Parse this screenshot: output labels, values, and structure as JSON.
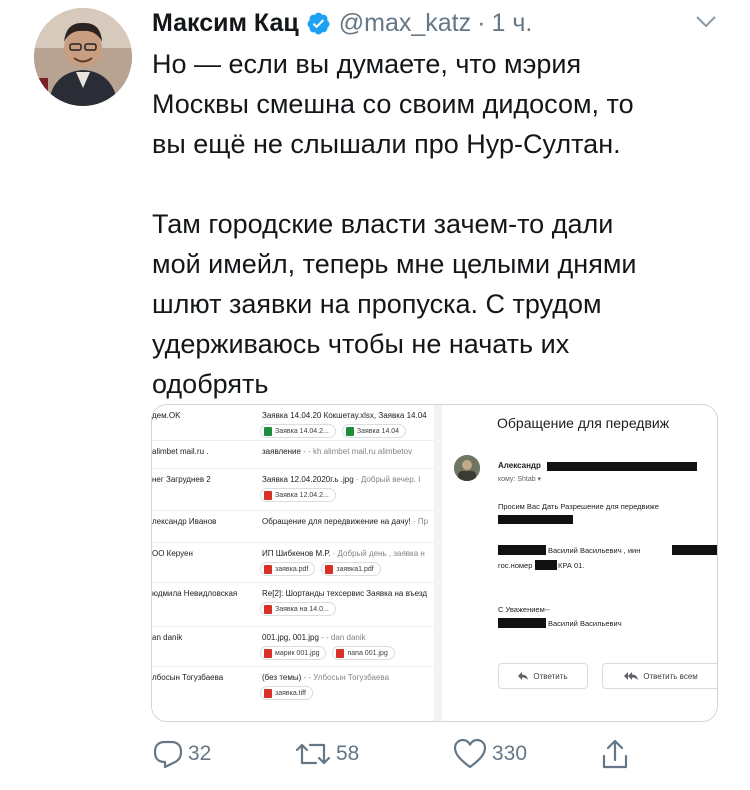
{
  "tweet": {
    "author_name": "Максим Кац",
    "handle": "@max_katz",
    "separator": "·",
    "time": "1 ч.",
    "text": "Но — если вы думаете, что мэрия\nМосквы смешна со своим дидосом, то\nвы ещё не слышали про Нур-Султан.\n\nТам городские власти зачем-то дали\nмой имейл, теперь мне целыми днями\nшлют заявки на пропуска. С трудом\nудерживаюсь чтобы не начать их\nодобрять"
  },
  "inbox": {
    "rows": [
      {
        "sender": "дем.OK",
        "subject": "Заявка 14.04.20 Кокшетау.xlsx, Заявка 14.04",
        "snippet": "",
        "attachments": [
          {
            "name": "Заявка 14.04.2...",
            "type": "xls"
          },
          {
            "name": "Заявка 14.04",
            "type": "xls"
          }
        ]
      },
      {
        "sender": "alimbet mail.ru .",
        "subject": "заявление",
        "snippet": " - - kh alimbet mail.ru alimbetov",
        "attachments": []
      },
      {
        "sender": "нег Загруднев 2",
        "subject": "Заявка 12.04.2020г.ь .jpg",
        "snippet": " · Добрый вечер. I",
        "attachments": [
          {
            "name": "Заявка 12.04.2...",
            "type": "img"
          }
        ]
      },
      {
        "sender": "лександр Иванов",
        "subject": "Обращение для передвижение на дачу!",
        "snippet": " · Пр",
        "attachments": []
      },
      {
        "sender": "ОО Керуен",
        "subject": "ИП Шибкенов М.Р.",
        "snippet": " · Добрый день , заявка н",
        "attachments": [
          {
            "name": "заявка.pdf",
            "type": "pdf"
          },
          {
            "name": "заявка1.pdf",
            "type": "pdf"
          }
        ]
      },
      {
        "sender": "юдмила Невидловская",
        "subject": "Re[2]: Шортанды техсервис Заявка на въезд",
        "snippet": "",
        "attachments": [
          {
            "name": "Заявка на 14.0...",
            "type": "img"
          }
        ]
      },
      {
        "sender": "an danik",
        "subject": "001.jpg, 001.jpg",
        "snippet": " - - dan danik",
        "attachments": [
          {
            "name": "марик 001.jpg",
            "type": "img"
          },
          {
            "name": "папа 001.jpg",
            "type": "img"
          }
        ]
      },
      {
        "sender": "лбосын Тогузбаева",
        "subject": "(без темы)",
        "snippet": " - - Улбосын Тогузбаева",
        "attachments": [
          {
            "name": "заявка.tiff",
            "type": "img"
          }
        ]
      }
    ]
  },
  "email": {
    "title": "Обращение для передвиж",
    "sender": "Александр",
    "to": "кому: Shtab ▾",
    "line1": "Просим Вас Дать Разрешение для передвиже",
    "line2_name": "Василий Васильевич , иин",
    "line3_prefix": "гос.номер",
    "line3_suffix": "КРА 01.",
    "regards": "С Уважением--",
    "signature": "Василий Васильевич",
    "reply_label": "Ответить",
    "reply_all_label": "Ответить всем"
  },
  "actions": {
    "replies": "32",
    "retweets": "58",
    "likes": "330"
  },
  "colors": {
    "verified": "#1da1f2",
    "secondary_text": "#657786",
    "border": "#ccd6dd"
  }
}
